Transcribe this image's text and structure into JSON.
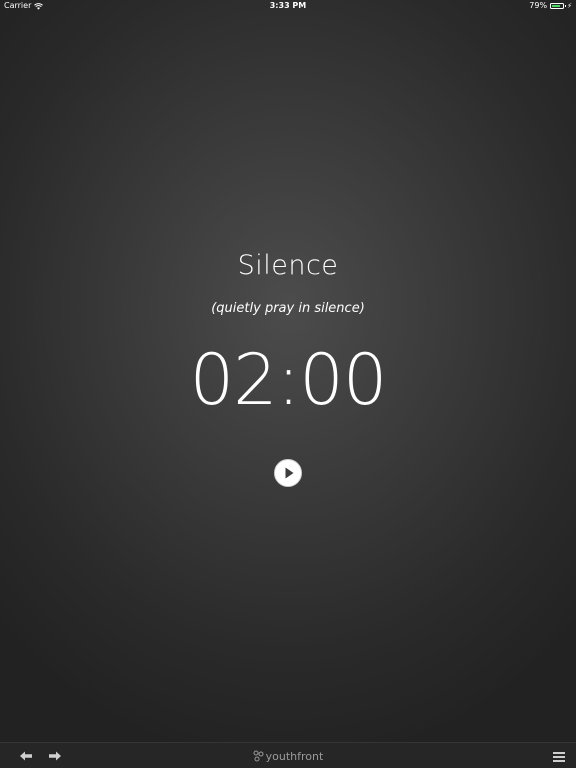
{
  "status_bar": {
    "carrier": "Carrier",
    "time": "3:33 PM",
    "battery_percent": "79%",
    "battery_level": 0.79,
    "battery_color": "#4cd964"
  },
  "main": {
    "title": "Silence",
    "subtitle": "(quietly pray in silence)",
    "timer": "02:00",
    "play_icon": "play-icon"
  },
  "toolbar": {
    "back_icon": "arrow-left-icon",
    "forward_icon": "arrow-right-icon",
    "logo_text": "youthfront",
    "menu_icon": "hamburger-menu-icon"
  }
}
